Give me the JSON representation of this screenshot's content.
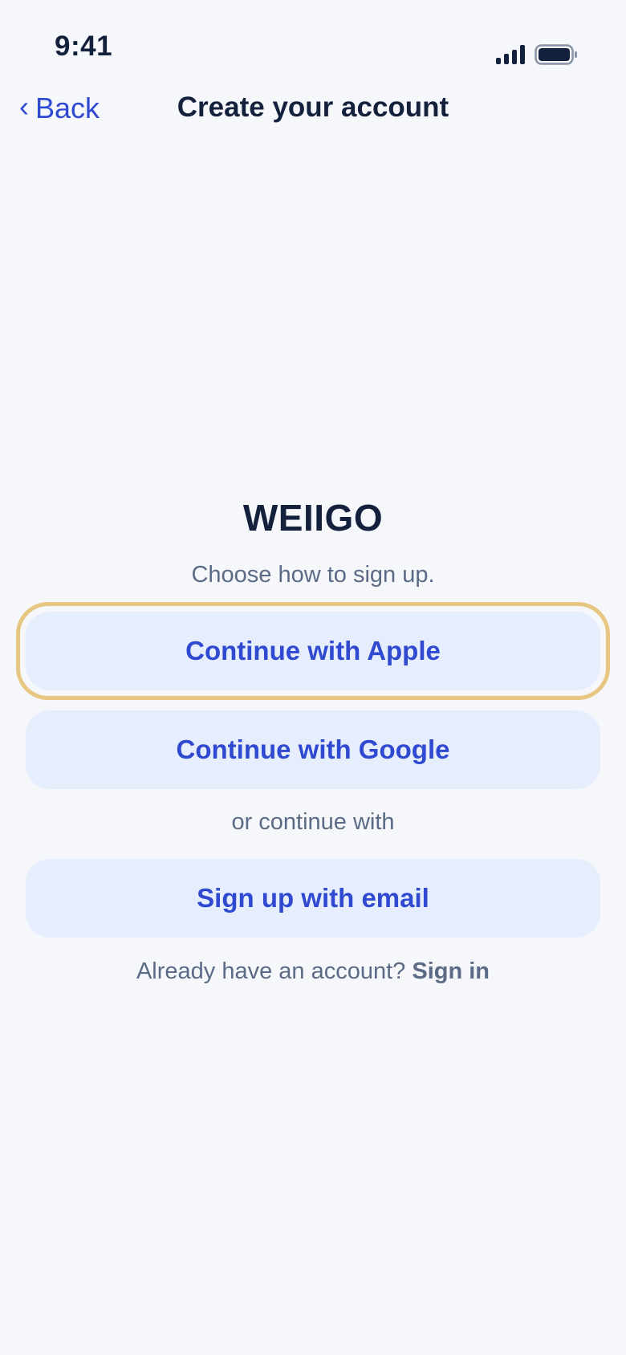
{
  "status_bar": {
    "time": "9:41",
    "icons": [
      "signal-icon",
      "battery-icon"
    ]
  },
  "nav": {
    "back_label": "Back",
    "back_icon": "chevron-left-icon",
    "title": "Create your account"
  },
  "brand": {
    "name": "WEIIGO",
    "subtitle": "Choose how to sign up."
  },
  "buttons": {
    "apple": "Continue with Apple",
    "google": "Continue with Google",
    "divider": "or continue with",
    "email": "Sign up with email"
  },
  "footer": {
    "prompt": "Already have an account?",
    "link": "Sign in"
  },
  "colors": {
    "accent": "#2f49d1",
    "background": "#f5f7fa",
    "button_bg": "#e6edfc",
    "focus_ring": "#e6c680",
    "title": "#14213d",
    "muted": "#5b6a85"
  }
}
